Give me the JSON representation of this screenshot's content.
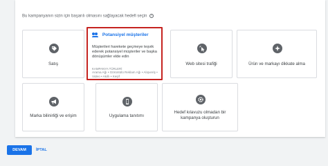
{
  "prompt": {
    "text": "Bu kampanyanın sizin için başarılı olmasını sağlayacak hedefi seçin"
  },
  "cards": {
    "sales": {
      "label": "Satış"
    },
    "leads": {
      "title": "Potansiyel müşteriler",
      "description": "Müşterileri harekete geçmeye teşvik ederek potansiyel müşteriler ve başka dönüşümler elde edin",
      "types_title": "KAMPANYA TÜRLERİ",
      "types": "Arama Ağı • Görüntülü Reklam Ağı • Alışveriş • Video • Akıllı • Keşif"
    },
    "website_traffic": {
      "label": "Web sitesi trafiği"
    },
    "consideration": {
      "label": "Ürün ve markayı dikkate alma"
    },
    "awareness": {
      "label": "Marka bilinirliği ve erişim"
    },
    "app_promotion": {
      "label": "Uygulama tanıtımı"
    },
    "no_goal": {
      "label": "Hedef kılavuzu olmadan bir kampanya oluşturun"
    }
  },
  "actions": {
    "continue": "DEVAM",
    "cancel": "İPTAL"
  },
  "colors": {
    "accent": "#1a73e8",
    "highlight": "#c5221f",
    "icon": "#5f6368"
  }
}
